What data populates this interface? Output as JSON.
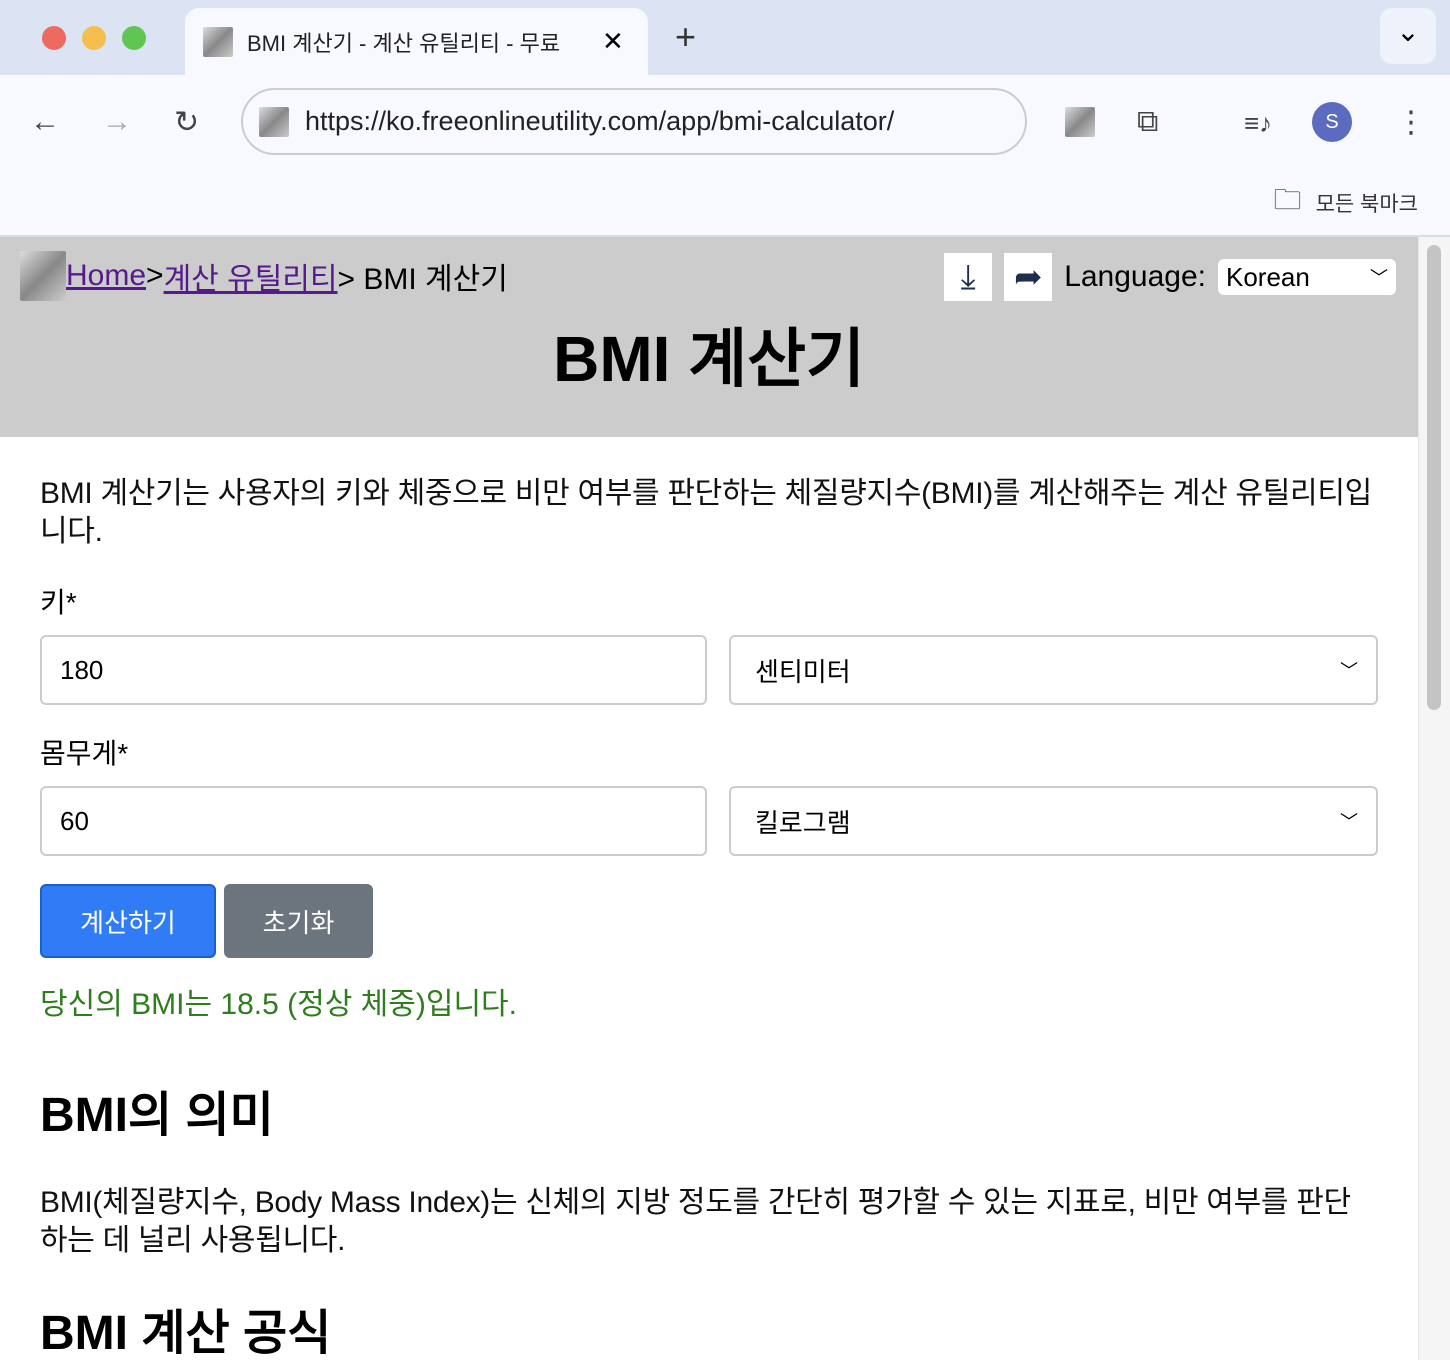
{
  "browser": {
    "tab_title": "BMI 계산기 - 계산 유틸리티 - 무료",
    "close": "✕",
    "new_tab": "+",
    "url": "https://ko.freeonlineutility.com/app/bmi-calculator/",
    "avatar": "S",
    "bookmarks": "모든 북마크",
    "tab_menu": "⌄"
  },
  "header": {
    "crumb_home": "Home",
    "crumb_sep1": ">",
    "crumb_cat": "계산 유틸리티",
    "crumb_current": "> BMI 계산기",
    "title": "BMI 계산기",
    "language_label": "Language:",
    "language_value": "Korean"
  },
  "main": {
    "intro": "BMI 계산기는 사용자의 키와 체중으로 비만 여부를 판단하는 체질량지수(BMI)를 계산해주는 계산 유틸리티입니다.",
    "height_label": "키*",
    "height_value": "180",
    "height_unit": "센티미터",
    "weight_label": "몸무게*",
    "weight_value": "60",
    "weight_unit": "킬로그램",
    "calc_button": "계산하기",
    "reset_button": "초기화",
    "result": "당신의 BMI는 18.5 (정상 체중)입니다.",
    "section1_title": "BMI의 의미",
    "section1_text": "BMI(체질량지수, Body Mass Index)는 신체의 지방 정도를 간단히 평가할 수 있는 지표로, 비만 여부를 판단하는 데 널리 사용됩니다.",
    "section2_title": "BMI 계산 공식"
  }
}
